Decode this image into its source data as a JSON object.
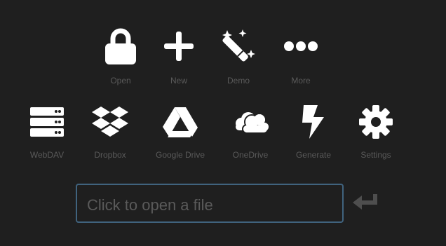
{
  "colors": {
    "background": "#1f1f1f",
    "icon": "#ffffff",
    "label": "#5a5a5a",
    "field_border": "#40637e",
    "enter_icon": "#4e4e4e"
  },
  "row1": [
    {
      "label": "Open",
      "icon": "lock-icon"
    },
    {
      "label": "New",
      "icon": "plus-icon"
    },
    {
      "label": "Demo",
      "icon": "magic-wand-icon"
    },
    {
      "label": "More",
      "icon": "ellipsis-icon"
    }
  ],
  "row2": [
    {
      "label": "WebDAV",
      "icon": "server-icon"
    },
    {
      "label": "Dropbox",
      "icon": "dropbox-icon"
    },
    {
      "label": "Google Drive",
      "icon": "google-drive-icon"
    },
    {
      "label": "OneDrive",
      "icon": "onedrive-icon"
    },
    {
      "label": "Generate",
      "icon": "lightning-icon"
    },
    {
      "label": "Settings",
      "icon": "gear-icon"
    }
  ],
  "open_field": {
    "placeholder": "Click to open a file"
  },
  "enter": {
    "icon": "enter-icon"
  }
}
